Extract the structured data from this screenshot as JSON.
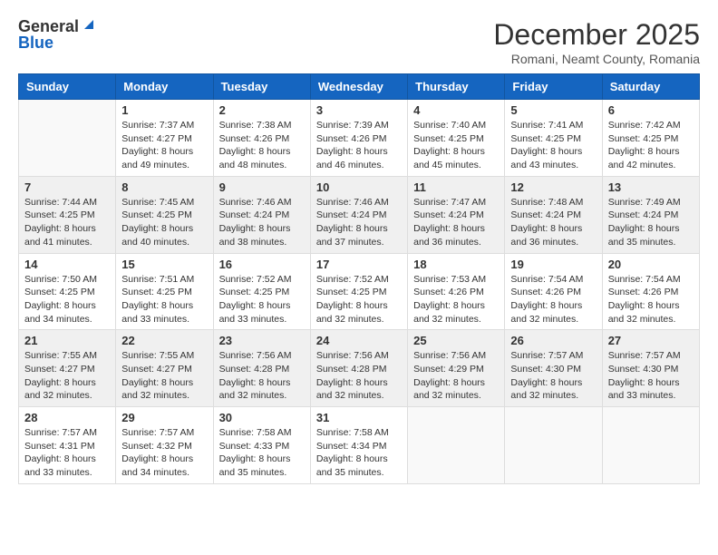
{
  "logo": {
    "general": "General",
    "blue": "Blue"
  },
  "title": {
    "month_year": "December 2025",
    "location": "Romani, Neamt County, Romania"
  },
  "weekdays": [
    "Sunday",
    "Monday",
    "Tuesday",
    "Wednesday",
    "Thursday",
    "Friday",
    "Saturday"
  ],
  "weeks": [
    [
      {
        "day": "",
        "sunrise": "",
        "sunset": "",
        "daylight": ""
      },
      {
        "day": "1",
        "sunrise": "Sunrise: 7:37 AM",
        "sunset": "Sunset: 4:27 PM",
        "daylight": "Daylight: 8 hours and 49 minutes."
      },
      {
        "day": "2",
        "sunrise": "Sunrise: 7:38 AM",
        "sunset": "Sunset: 4:26 PM",
        "daylight": "Daylight: 8 hours and 48 minutes."
      },
      {
        "day": "3",
        "sunrise": "Sunrise: 7:39 AM",
        "sunset": "Sunset: 4:26 PM",
        "daylight": "Daylight: 8 hours and 46 minutes."
      },
      {
        "day": "4",
        "sunrise": "Sunrise: 7:40 AM",
        "sunset": "Sunset: 4:25 PM",
        "daylight": "Daylight: 8 hours and 45 minutes."
      },
      {
        "day": "5",
        "sunrise": "Sunrise: 7:41 AM",
        "sunset": "Sunset: 4:25 PM",
        "daylight": "Daylight: 8 hours and 43 minutes."
      },
      {
        "day": "6",
        "sunrise": "Sunrise: 7:42 AM",
        "sunset": "Sunset: 4:25 PM",
        "daylight": "Daylight: 8 hours and 42 minutes."
      }
    ],
    [
      {
        "day": "7",
        "sunrise": "Sunrise: 7:44 AM",
        "sunset": "Sunset: 4:25 PM",
        "daylight": "Daylight: 8 hours and 41 minutes."
      },
      {
        "day": "8",
        "sunrise": "Sunrise: 7:45 AM",
        "sunset": "Sunset: 4:25 PM",
        "daylight": "Daylight: 8 hours and 40 minutes."
      },
      {
        "day": "9",
        "sunrise": "Sunrise: 7:46 AM",
        "sunset": "Sunset: 4:24 PM",
        "daylight": "Daylight: 8 hours and 38 minutes."
      },
      {
        "day": "10",
        "sunrise": "Sunrise: 7:46 AM",
        "sunset": "Sunset: 4:24 PM",
        "daylight": "Daylight: 8 hours and 37 minutes."
      },
      {
        "day": "11",
        "sunrise": "Sunrise: 7:47 AM",
        "sunset": "Sunset: 4:24 PM",
        "daylight": "Daylight: 8 hours and 36 minutes."
      },
      {
        "day": "12",
        "sunrise": "Sunrise: 7:48 AM",
        "sunset": "Sunset: 4:24 PM",
        "daylight": "Daylight: 8 hours and 36 minutes."
      },
      {
        "day": "13",
        "sunrise": "Sunrise: 7:49 AM",
        "sunset": "Sunset: 4:24 PM",
        "daylight": "Daylight: 8 hours and 35 minutes."
      }
    ],
    [
      {
        "day": "14",
        "sunrise": "Sunrise: 7:50 AM",
        "sunset": "Sunset: 4:25 PM",
        "daylight": "Daylight: 8 hours and 34 minutes."
      },
      {
        "day": "15",
        "sunrise": "Sunrise: 7:51 AM",
        "sunset": "Sunset: 4:25 PM",
        "daylight": "Daylight: 8 hours and 33 minutes."
      },
      {
        "day": "16",
        "sunrise": "Sunrise: 7:52 AM",
        "sunset": "Sunset: 4:25 PM",
        "daylight": "Daylight: 8 hours and 33 minutes."
      },
      {
        "day": "17",
        "sunrise": "Sunrise: 7:52 AM",
        "sunset": "Sunset: 4:25 PM",
        "daylight": "Daylight: 8 hours and 32 minutes."
      },
      {
        "day": "18",
        "sunrise": "Sunrise: 7:53 AM",
        "sunset": "Sunset: 4:26 PM",
        "daylight": "Daylight: 8 hours and 32 minutes."
      },
      {
        "day": "19",
        "sunrise": "Sunrise: 7:54 AM",
        "sunset": "Sunset: 4:26 PM",
        "daylight": "Daylight: 8 hours and 32 minutes."
      },
      {
        "day": "20",
        "sunrise": "Sunrise: 7:54 AM",
        "sunset": "Sunset: 4:26 PM",
        "daylight": "Daylight: 8 hours and 32 minutes."
      }
    ],
    [
      {
        "day": "21",
        "sunrise": "Sunrise: 7:55 AM",
        "sunset": "Sunset: 4:27 PM",
        "daylight": "Daylight: 8 hours and 32 minutes."
      },
      {
        "day": "22",
        "sunrise": "Sunrise: 7:55 AM",
        "sunset": "Sunset: 4:27 PM",
        "daylight": "Daylight: 8 hours and 32 minutes."
      },
      {
        "day": "23",
        "sunrise": "Sunrise: 7:56 AM",
        "sunset": "Sunset: 4:28 PM",
        "daylight": "Daylight: 8 hours and 32 minutes."
      },
      {
        "day": "24",
        "sunrise": "Sunrise: 7:56 AM",
        "sunset": "Sunset: 4:28 PM",
        "daylight": "Daylight: 8 hours and 32 minutes."
      },
      {
        "day": "25",
        "sunrise": "Sunrise: 7:56 AM",
        "sunset": "Sunset: 4:29 PM",
        "daylight": "Daylight: 8 hours and 32 minutes."
      },
      {
        "day": "26",
        "sunrise": "Sunrise: 7:57 AM",
        "sunset": "Sunset: 4:30 PM",
        "daylight": "Daylight: 8 hours and 32 minutes."
      },
      {
        "day": "27",
        "sunrise": "Sunrise: 7:57 AM",
        "sunset": "Sunset: 4:30 PM",
        "daylight": "Daylight: 8 hours and 33 minutes."
      }
    ],
    [
      {
        "day": "28",
        "sunrise": "Sunrise: 7:57 AM",
        "sunset": "Sunset: 4:31 PM",
        "daylight": "Daylight: 8 hours and 33 minutes."
      },
      {
        "day": "29",
        "sunrise": "Sunrise: 7:57 AM",
        "sunset": "Sunset: 4:32 PM",
        "daylight": "Daylight: 8 hours and 34 minutes."
      },
      {
        "day": "30",
        "sunrise": "Sunrise: 7:58 AM",
        "sunset": "Sunset: 4:33 PM",
        "daylight": "Daylight: 8 hours and 35 minutes."
      },
      {
        "day": "31",
        "sunrise": "Sunrise: 7:58 AM",
        "sunset": "Sunset: 4:34 PM",
        "daylight": "Daylight: 8 hours and 35 minutes."
      },
      {
        "day": "",
        "sunrise": "",
        "sunset": "",
        "daylight": ""
      },
      {
        "day": "",
        "sunrise": "",
        "sunset": "",
        "daylight": ""
      },
      {
        "day": "",
        "sunrise": "",
        "sunset": "",
        "daylight": ""
      }
    ]
  ]
}
